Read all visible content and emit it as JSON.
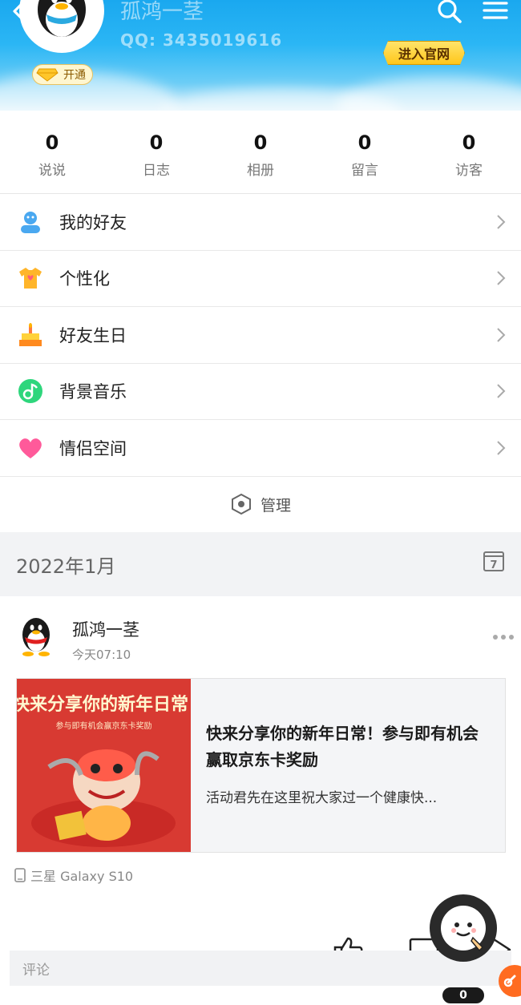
{
  "header": {
    "user_name": "孤鸿一茎",
    "qq_number": "QQ: 3435019616",
    "vip_label": "开通",
    "official_site_label": "进入官网"
  },
  "stats": [
    {
      "value": "0",
      "label": "说说"
    },
    {
      "value": "0",
      "label": "日志"
    },
    {
      "value": "0",
      "label": "相册"
    },
    {
      "value": "0",
      "label": "留言"
    },
    {
      "value": "0",
      "label": "访客"
    }
  ],
  "menu": {
    "items": [
      {
        "label": "我的好友",
        "icon": "friends-icon"
      },
      {
        "label": "个性化",
        "icon": "tshirt-icon"
      },
      {
        "label": "好友生日",
        "icon": "cake-icon"
      },
      {
        "label": "背景音乐",
        "icon": "music-icon"
      },
      {
        "label": "情侣空间",
        "icon": "heart-icon"
      }
    ],
    "manage_label": "管理"
  },
  "timeline": {
    "date_label": "2022年1月",
    "calendar_day": "7"
  },
  "post": {
    "author": "孤鸿一茎",
    "time": "今天07:10",
    "card": {
      "image_headline": "快来分享你的新年日常",
      "image_sub": "参与即有机会赢京东卡奖励",
      "title": "快来分享你的新年日常！参与即有机会赢取京东卡奖励",
      "description": "活动君先在这里祝大家过一个健康快..."
    },
    "device": "三星 Galaxy S10",
    "comment_placeholder": "评论",
    "float_count": "0"
  },
  "colors": {
    "banner_top": "#1aa8ef",
    "official_button": "#ffc61b",
    "card_image_bg": "#d83a32"
  }
}
